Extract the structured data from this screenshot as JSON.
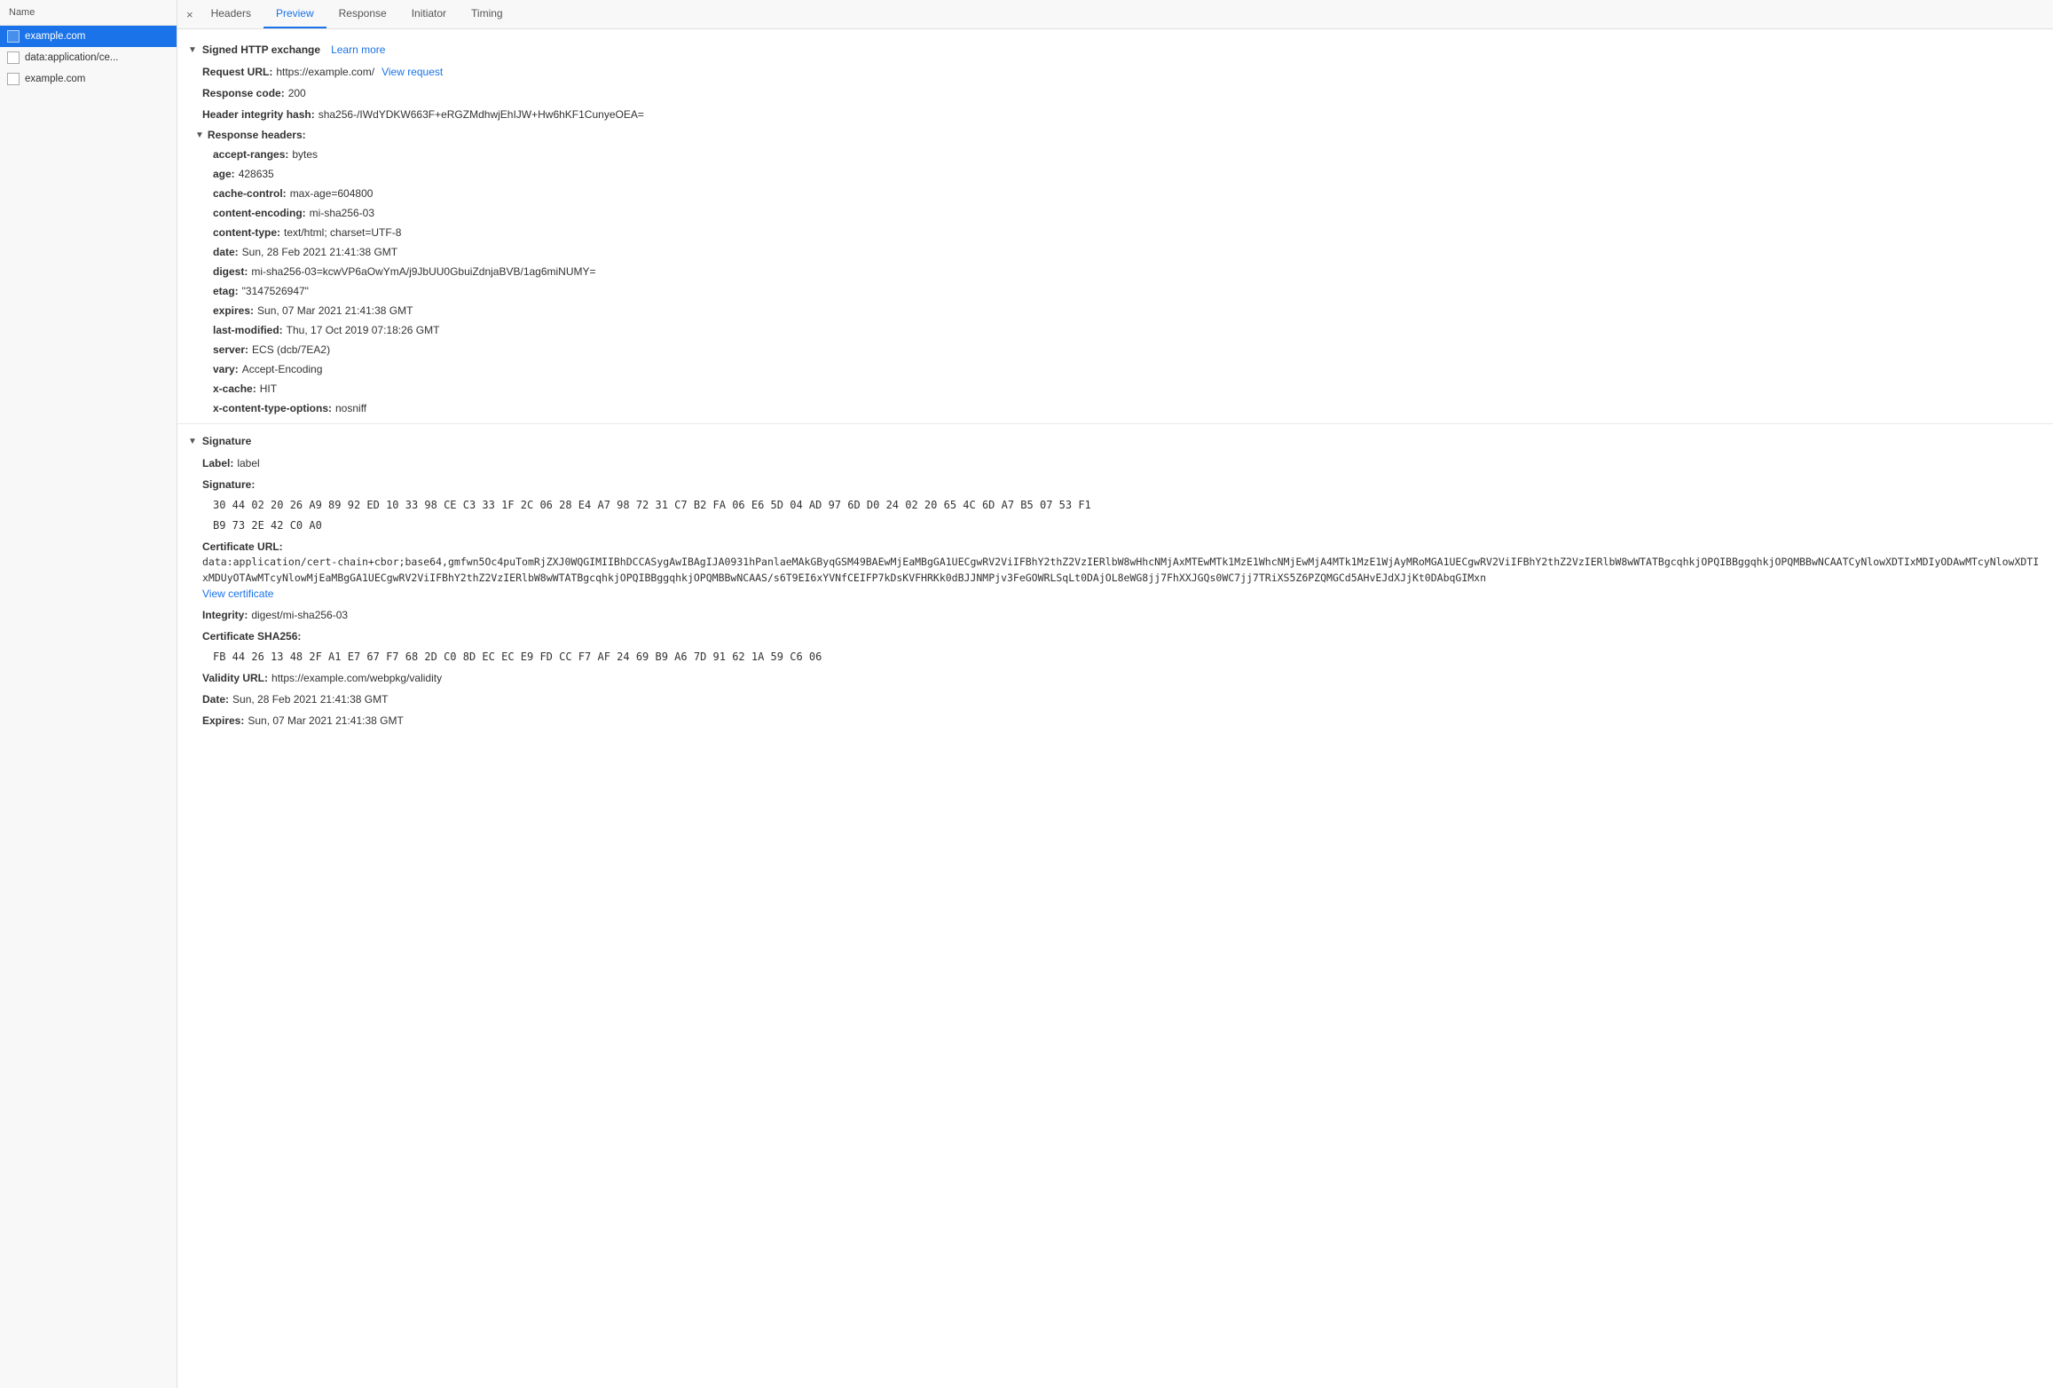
{
  "sidebar": {
    "header": "Name",
    "items": [
      {
        "id": "item-example-com-main",
        "label": "example.com",
        "active": true
      },
      {
        "id": "item-data-app",
        "label": "data:application/ce...",
        "active": false
      },
      {
        "id": "item-example-com-2",
        "label": "example.com",
        "active": false
      }
    ]
  },
  "tabs": {
    "close_label": "×",
    "items": [
      {
        "id": "tab-headers",
        "label": "Headers",
        "active": false
      },
      {
        "id": "tab-preview",
        "label": "Preview",
        "active": true
      },
      {
        "id": "tab-response",
        "label": "Response",
        "active": false
      },
      {
        "id": "tab-initiator",
        "label": "Initiator",
        "active": false
      },
      {
        "id": "tab-timing",
        "label": "Timing",
        "active": false
      }
    ]
  },
  "signed_http_exchange": {
    "section_label": "Signed HTTP exchange",
    "learn_more_label": "Learn more",
    "request_url_key": "Request URL:",
    "request_url_value": "https://example.com/",
    "view_request_label": "View request",
    "response_code_key": "Response code:",
    "response_code_value": "200",
    "header_integrity_hash_key": "Header integrity hash:",
    "header_integrity_hash_value": "sha256-/IWdYDKW663F+eRGZMdhwjEhIJW+Hw6hKF1CunyeOEA=",
    "response_headers_label": "Response headers:",
    "headers": [
      {
        "key": "accept-ranges:",
        "value": "bytes"
      },
      {
        "key": "age:",
        "value": "428635"
      },
      {
        "key": "cache-control:",
        "value": "max-age=604800"
      },
      {
        "key": "content-encoding:",
        "value": "mi-sha256-03"
      },
      {
        "key": "content-type:",
        "value": "text/html; charset=UTF-8"
      },
      {
        "key": "date:",
        "value": "Sun, 28 Feb 2021 21:41:38 GMT"
      },
      {
        "key": "digest:",
        "value": "mi-sha256-03=kcwVP6aOwYmA/j9JbUU0GbuiZdnjaBVB/1ag6miNUMY="
      },
      {
        "key": "etag:",
        "value": "\"3147526947\""
      },
      {
        "key": "expires:",
        "value": "Sun, 07 Mar 2021 21:41:38 GMT"
      },
      {
        "key": "last-modified:",
        "value": "Thu, 17 Oct 2019 07:18:26 GMT"
      },
      {
        "key": "server:",
        "value": "ECS (dcb/7EA2)"
      },
      {
        "key": "vary:",
        "value": "Accept-Encoding"
      },
      {
        "key": "x-cache:",
        "value": "HIT"
      },
      {
        "key": "x-content-type-options:",
        "value": "nosniff"
      }
    ]
  },
  "signature": {
    "section_label": "Signature",
    "label_key": "Label:",
    "label_value": "label",
    "signature_key": "Signature:",
    "signature_bytes_line1": "30 44 02 20 26 A9 89 92 ED 10 33 98 CE C3 33 1F 2C 06 28 E4 A7 98 72 31 C7 B2 FA 06 E6 5D 04 AD 97 6D D0 24 02 20 65 4C 6D A7 B5 07 53 F1",
    "signature_bytes_line2": "B9 73 2E 42 C0 A0",
    "certificate_url_key": "Certificate URL:",
    "certificate_url_value": "data:application/cert-chain+cbor;base64,gmfwn5Oc4puTomRjZXJ0WQGIMIIBhDCCASygAwIBAgIJA0931hPanlaeMAkGByqGSM49BAEwMjEaMBgGA1UECgwRV2ViIFBhY2thZ2VzIERlbW8wHhcNMjAxMTEwMTk1MzE1WhcNMjEwMjA4MTk1MzE1WjAyMRoMGA1UECgwRV2ViIFBhY2thZ2VzIERlbW8wWTATBgcqhkjOPQIBBggqhkjOPQMBBwNCAATCyNlowXDTIxMDIyODAwMTcyNlowXDTIxMDUyOTAwMTcyNlowMjEaMBgGA1UECgwRV2ViIFBhY2thZ2VzIERlbW8wWTATBgcqhkjOPQIBBggqhkjOPQMBBwNCAAS/s6T9EI6xYVNfCEIFP7kDsKVFHRKk0dBJJNMPjv3FeGOWRLSqLt0DAjOL8eWG8jj7FhXXJGQs0WC7jj7TRiXS5Z6PZQMGCd5AHvEJdXJjKt0DAbqGIMxn",
    "view_certificate_label": "View certificate",
    "integrity_key": "Integrity:",
    "integrity_value": "digest/mi-sha256-03",
    "certificate_sha256_key": "Certificate SHA256:",
    "certificate_sha256_value": "FB 44 26 13 48 2F A1 E7 67 F7 68 2D C0 8D EC EC E9 FD CC F7 AF 24 69 B9 A6 7D 91 62 1A 59 C6 06",
    "validity_url_key": "Validity URL:",
    "validity_url_value": "https://example.com/webpkg/validity",
    "date_key": "Date:",
    "date_value": "Sun, 28 Feb 2021 21:41:38 GMT",
    "expires_key": "Expires:",
    "expires_value": "Sun, 07 Mar 2021 21:41:38 GMT"
  },
  "colors": {
    "active_tab_color": "#1a73e8",
    "active_sidebar_bg": "#1a73e8",
    "link_color": "#1a73e8"
  }
}
